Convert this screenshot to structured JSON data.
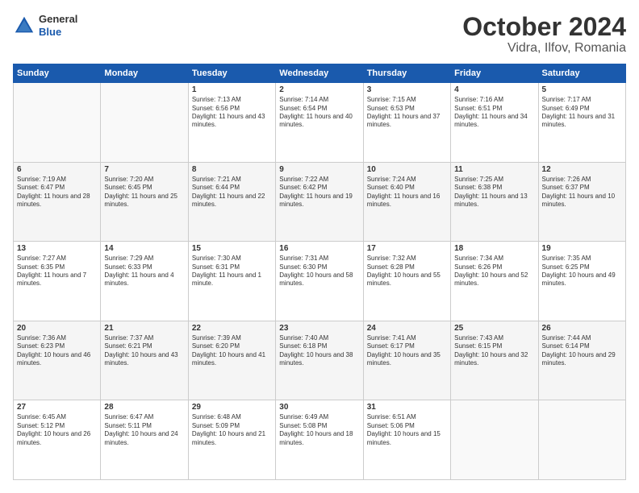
{
  "header": {
    "logo_line1": "General",
    "logo_line2": "Blue",
    "month_year": "October 2024",
    "location": "Vidra, Ilfov, Romania"
  },
  "days_of_week": [
    "Sunday",
    "Monday",
    "Tuesday",
    "Wednesday",
    "Thursday",
    "Friday",
    "Saturday"
  ],
  "weeks": [
    [
      {
        "day": "",
        "content": ""
      },
      {
        "day": "",
        "content": ""
      },
      {
        "day": "1",
        "content": "Sunrise: 7:13 AM\nSunset: 6:56 PM\nDaylight: 11 hours and 43 minutes."
      },
      {
        "day": "2",
        "content": "Sunrise: 7:14 AM\nSunset: 6:54 PM\nDaylight: 11 hours and 40 minutes."
      },
      {
        "day": "3",
        "content": "Sunrise: 7:15 AM\nSunset: 6:53 PM\nDaylight: 11 hours and 37 minutes."
      },
      {
        "day": "4",
        "content": "Sunrise: 7:16 AM\nSunset: 6:51 PM\nDaylight: 11 hours and 34 minutes."
      },
      {
        "day": "5",
        "content": "Sunrise: 7:17 AM\nSunset: 6:49 PM\nDaylight: 11 hours and 31 minutes."
      }
    ],
    [
      {
        "day": "6",
        "content": "Sunrise: 7:19 AM\nSunset: 6:47 PM\nDaylight: 11 hours and 28 minutes."
      },
      {
        "day": "7",
        "content": "Sunrise: 7:20 AM\nSunset: 6:45 PM\nDaylight: 11 hours and 25 minutes."
      },
      {
        "day": "8",
        "content": "Sunrise: 7:21 AM\nSunset: 6:44 PM\nDaylight: 11 hours and 22 minutes."
      },
      {
        "day": "9",
        "content": "Sunrise: 7:22 AM\nSunset: 6:42 PM\nDaylight: 11 hours and 19 minutes."
      },
      {
        "day": "10",
        "content": "Sunrise: 7:24 AM\nSunset: 6:40 PM\nDaylight: 11 hours and 16 minutes."
      },
      {
        "day": "11",
        "content": "Sunrise: 7:25 AM\nSunset: 6:38 PM\nDaylight: 11 hours and 13 minutes."
      },
      {
        "day": "12",
        "content": "Sunrise: 7:26 AM\nSunset: 6:37 PM\nDaylight: 11 hours and 10 minutes."
      }
    ],
    [
      {
        "day": "13",
        "content": "Sunrise: 7:27 AM\nSunset: 6:35 PM\nDaylight: 11 hours and 7 minutes."
      },
      {
        "day": "14",
        "content": "Sunrise: 7:29 AM\nSunset: 6:33 PM\nDaylight: 11 hours and 4 minutes."
      },
      {
        "day": "15",
        "content": "Sunrise: 7:30 AM\nSunset: 6:31 PM\nDaylight: 11 hours and 1 minute."
      },
      {
        "day": "16",
        "content": "Sunrise: 7:31 AM\nSunset: 6:30 PM\nDaylight: 10 hours and 58 minutes."
      },
      {
        "day": "17",
        "content": "Sunrise: 7:32 AM\nSunset: 6:28 PM\nDaylight: 10 hours and 55 minutes."
      },
      {
        "day": "18",
        "content": "Sunrise: 7:34 AM\nSunset: 6:26 PM\nDaylight: 10 hours and 52 minutes."
      },
      {
        "day": "19",
        "content": "Sunrise: 7:35 AM\nSunset: 6:25 PM\nDaylight: 10 hours and 49 minutes."
      }
    ],
    [
      {
        "day": "20",
        "content": "Sunrise: 7:36 AM\nSunset: 6:23 PM\nDaylight: 10 hours and 46 minutes."
      },
      {
        "day": "21",
        "content": "Sunrise: 7:37 AM\nSunset: 6:21 PM\nDaylight: 10 hours and 43 minutes."
      },
      {
        "day": "22",
        "content": "Sunrise: 7:39 AM\nSunset: 6:20 PM\nDaylight: 10 hours and 41 minutes."
      },
      {
        "day": "23",
        "content": "Sunrise: 7:40 AM\nSunset: 6:18 PM\nDaylight: 10 hours and 38 minutes."
      },
      {
        "day": "24",
        "content": "Sunrise: 7:41 AM\nSunset: 6:17 PM\nDaylight: 10 hours and 35 minutes."
      },
      {
        "day": "25",
        "content": "Sunrise: 7:43 AM\nSunset: 6:15 PM\nDaylight: 10 hours and 32 minutes."
      },
      {
        "day": "26",
        "content": "Sunrise: 7:44 AM\nSunset: 6:14 PM\nDaylight: 10 hours and 29 minutes."
      }
    ],
    [
      {
        "day": "27",
        "content": "Sunrise: 6:45 AM\nSunset: 5:12 PM\nDaylight: 10 hours and 26 minutes."
      },
      {
        "day": "28",
        "content": "Sunrise: 6:47 AM\nSunset: 5:11 PM\nDaylight: 10 hours and 24 minutes."
      },
      {
        "day": "29",
        "content": "Sunrise: 6:48 AM\nSunset: 5:09 PM\nDaylight: 10 hours and 21 minutes."
      },
      {
        "day": "30",
        "content": "Sunrise: 6:49 AM\nSunset: 5:08 PM\nDaylight: 10 hours and 18 minutes."
      },
      {
        "day": "31",
        "content": "Sunrise: 6:51 AM\nSunset: 5:06 PM\nDaylight: 10 hours and 15 minutes."
      },
      {
        "day": "",
        "content": ""
      },
      {
        "day": "",
        "content": ""
      }
    ]
  ]
}
